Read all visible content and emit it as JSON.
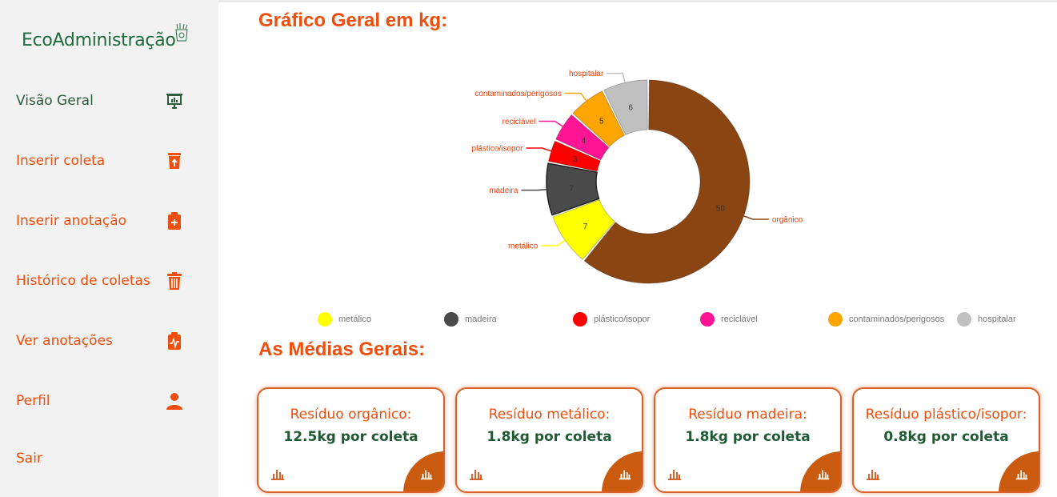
{
  "sidebar": {
    "brand": "EcoAdministração",
    "items": [
      {
        "label": "Visão Geral",
        "icon": "presentation-chart-icon"
      },
      {
        "label": "Inserir coleta",
        "icon": "trash-upload-icon"
      },
      {
        "label": "Inserir anotação",
        "icon": "clipboard-plus-icon"
      },
      {
        "label": "Histórico de coletas",
        "icon": "trash-icon"
      },
      {
        "label": "Ver anotações",
        "icon": "clipboard-pulse-icon"
      },
      {
        "label": "Perfil",
        "icon": "user-icon"
      },
      {
        "label": "Sair",
        "icon": ""
      }
    ]
  },
  "main": {
    "chart_title": "Gráfico Geral em kg:",
    "averages_title": "As Médias Gerais:"
  },
  "chart_data": {
    "type": "pie",
    "categories": [
      "orgânico",
      "metálico",
      "madeira",
      "plástico/isopor",
      "reciclável",
      "contaminados/perigosos",
      "hospitalar"
    ],
    "values": [
      50,
      7,
      7,
      3,
      4,
      5,
      6
    ],
    "colors": [
      "#8b4513",
      "#ffff00",
      "#4a4a4a",
      "#ff0000",
      "#ff1493",
      "#ffa500",
      "#c0c0c0"
    ],
    "legend": [
      "metálico",
      "madeira",
      "plástico/isopor",
      "reciclável",
      "contaminados/perigosos",
      "hospitalar"
    ],
    "legend_colors": [
      "#ffff00",
      "#4a4a4a",
      "#ff0000",
      "#ff1493",
      "#ffa500",
      "#c0c0c0"
    ],
    "donut": true,
    "legend_position": "bottom"
  },
  "cards": [
    {
      "title": "Resíduo orgânico:",
      "value": "12.5kg por coleta"
    },
    {
      "title": "Resíduo metálico:",
      "value": "1.8kg por coleta"
    },
    {
      "title": "Resíduo madeira:",
      "value": "1.8kg por coleta"
    },
    {
      "title": "Resíduo plástico/isopor:",
      "value": "0.8kg por coleta"
    }
  ],
  "colors": {
    "accent": "#f04e0c",
    "brand_green": "#1e6b3c",
    "card_corner": "#c95a0e"
  }
}
